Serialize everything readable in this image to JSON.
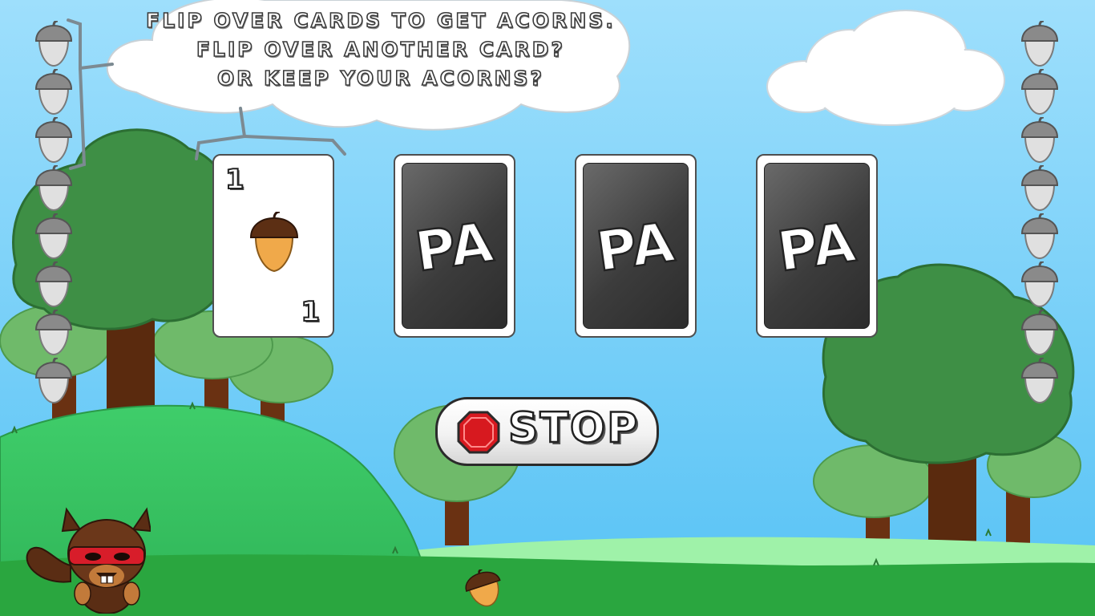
{
  "speech_bubble": {
    "lines": [
      "Flip over cards to get acorns.",
      "Flip over another card?",
      "Or keep your acorns?"
    ]
  },
  "acorn_counters": {
    "left_count": 8,
    "right_count": 8
  },
  "cards": [
    {
      "state": "face-up",
      "value_top": "1",
      "value_bottom": "1",
      "icon": "acorn-icon"
    },
    {
      "state": "face-down",
      "logo": "PA"
    },
    {
      "state": "face-down",
      "logo": "PA"
    },
    {
      "state": "face-down",
      "logo": "PA"
    }
  ],
  "stop_button": {
    "label": "STOP",
    "icon": "stop-sign-icon"
  },
  "colors": {
    "sky_top": "#8ed8fb",
    "sky_bottom": "#5ec7f6",
    "hill": "#3cc764",
    "grass_far": "#9ff2a9",
    "tree_green": "#3e8f45",
    "trunk": "#5a2a0e",
    "acorn_counter": "#dedede"
  }
}
